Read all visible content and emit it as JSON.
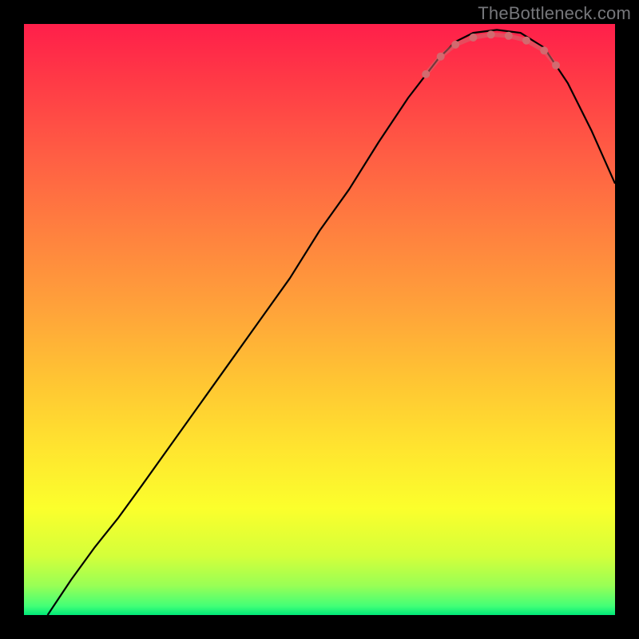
{
  "watermark": "TheBottleneck.com",
  "chart_data": {
    "type": "line",
    "title": "",
    "xlabel": "",
    "ylabel": "",
    "xlim": [
      0,
      100
    ],
    "ylim": [
      100,
      0
    ],
    "grid": false,
    "legend": false,
    "background_gradient_stops": [
      {
        "offset": 0.0,
        "color": "#ff1f4a"
      },
      {
        "offset": 0.1,
        "color": "#ff3b46"
      },
      {
        "offset": 0.22,
        "color": "#ff5d44"
      },
      {
        "offset": 0.35,
        "color": "#ff803f"
      },
      {
        "offset": 0.48,
        "color": "#ffa23a"
      },
      {
        "offset": 0.6,
        "color": "#ffc433"
      },
      {
        "offset": 0.72,
        "color": "#ffe52f"
      },
      {
        "offset": 0.82,
        "color": "#fbff2c"
      },
      {
        "offset": 0.9,
        "color": "#d4ff3a"
      },
      {
        "offset": 0.95,
        "color": "#99ff55"
      },
      {
        "offset": 0.985,
        "color": "#42ff77"
      },
      {
        "offset": 1.0,
        "color": "#00e878"
      }
    ],
    "series": [
      {
        "name": "bottleneck-curve",
        "stroke": "#000000",
        "stroke_width": 2.2,
        "points": [
          {
            "x": 4.0,
            "y": 0.0
          },
          {
            "x": 8.0,
            "y": 6.0
          },
          {
            "x": 12.0,
            "y": 11.5
          },
          {
            "x": 16.0,
            "y": 16.5
          },
          {
            "x": 20.0,
            "y": 22.0
          },
          {
            "x": 25.0,
            "y": 29.0
          },
          {
            "x": 30.0,
            "y": 36.0
          },
          {
            "x": 35.0,
            "y": 43.0
          },
          {
            "x": 40.0,
            "y": 50.0
          },
          {
            "x": 45.0,
            "y": 57.0
          },
          {
            "x": 50.0,
            "y": 65.0
          },
          {
            "x": 55.0,
            "y": 72.0
          },
          {
            "x": 60.0,
            "y": 80.0
          },
          {
            "x": 65.0,
            "y": 87.5
          },
          {
            "x": 70.0,
            "y": 94.0
          },
          {
            "x": 73.0,
            "y": 97.0
          },
          {
            "x": 76.0,
            "y": 98.5
          },
          {
            "x": 80.0,
            "y": 99.0
          },
          {
            "x": 84.0,
            "y": 98.5
          },
          {
            "x": 88.0,
            "y": 96.0
          },
          {
            "x": 92.0,
            "y": 90.0
          },
          {
            "x": 96.0,
            "y": 82.0
          },
          {
            "x": 100.0,
            "y": 73.0
          }
        ]
      },
      {
        "name": "optimal-zone-marker",
        "stroke": "#d26a6f",
        "stroke_width": 10,
        "linecap": "round",
        "points": [
          {
            "x": 68.0,
            "y": 91.5
          },
          {
            "x": 70.5,
            "y": 94.5
          },
          {
            "x": 73.0,
            "y": 96.5
          },
          {
            "x": 76.0,
            "y": 97.7
          },
          {
            "x": 79.0,
            "y": 98.2
          },
          {
            "x": 82.0,
            "y": 98.0
          },
          {
            "x": 85.0,
            "y": 97.2
          },
          {
            "x": 88.0,
            "y": 95.5
          },
          {
            "x": 90.0,
            "y": 93.0
          }
        ]
      }
    ]
  }
}
